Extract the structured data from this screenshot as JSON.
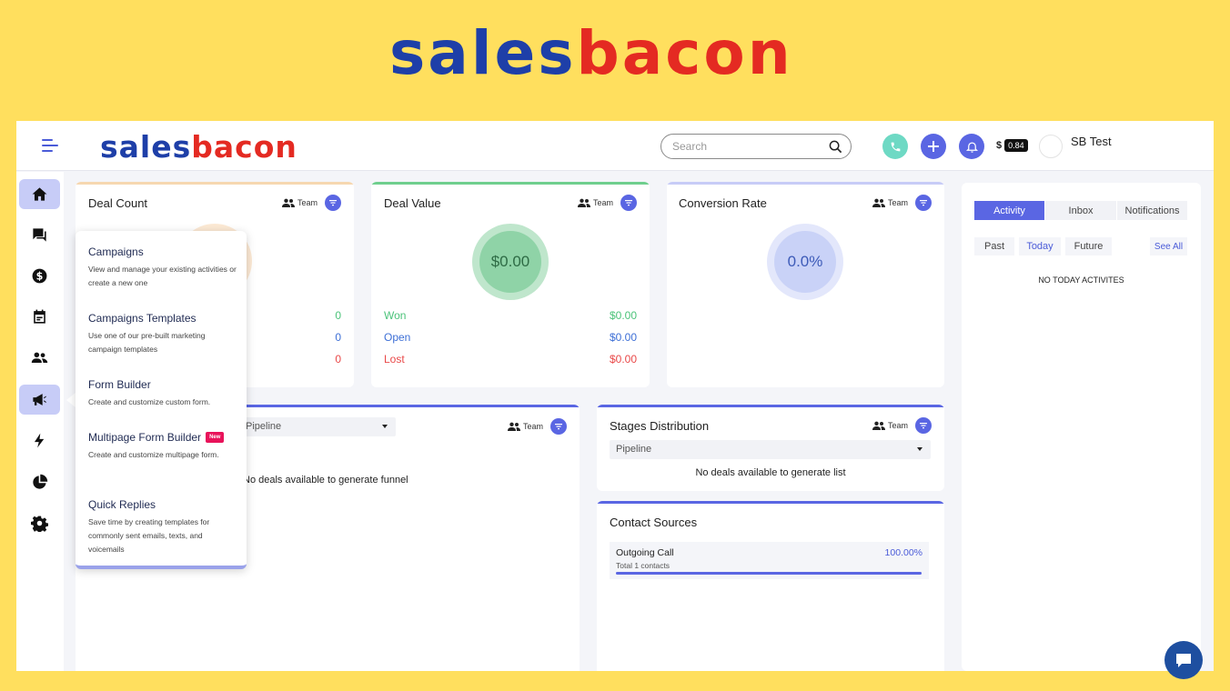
{
  "brand": {
    "part1": "sales",
    "part2": "bacon",
    "blue": "#1E3FA8",
    "red": "#E42A22"
  },
  "header": {
    "search_placeholder": "Search",
    "balance_symbol": "$",
    "balance_value": "0.84",
    "user_name": "SB Test"
  },
  "sidebar": {
    "items": [
      "home-icon",
      "chat-icon",
      "dollar-icon",
      "calendar-icon",
      "contacts-icon",
      "megaphone-icon",
      "bolt-icon",
      "pie-chart-icon",
      "gear-icon"
    ],
    "active": [
      "home-icon",
      "megaphone-icon"
    ]
  },
  "deal_count": {
    "title": "Deal Count",
    "team": "Team",
    "rows": [
      "0",
      "0",
      "0"
    ]
  },
  "deal_value": {
    "title": "Deal Value",
    "team": "Team",
    "total": "$0.00",
    "rows": [
      {
        "label": "Won",
        "value": "$0.00",
        "color": "#4CC37A"
      },
      {
        "label": "Open",
        "value": "$0.00",
        "color": "#3D6FD6"
      },
      {
        "label": "Lost",
        "value": "$0.00",
        "color": "#E94848"
      }
    ]
  },
  "conversion_rate": {
    "title": "Conversion Rate",
    "team": "Team",
    "value": "0.0%"
  },
  "funnel": {
    "select": "Pipeline",
    "team": "Team",
    "empty": "No deals available to generate funnel"
  },
  "stages": {
    "title": "Stages Distribution",
    "team": "Team",
    "select": "Pipeline",
    "empty": "No deals available to generate list"
  },
  "contact_sources": {
    "title": "Contact Sources",
    "items": [
      {
        "name": "Outgoing Call",
        "sub": "Total 1 contacts",
        "percent": "100.00%",
        "fraction": 1.0
      }
    ]
  },
  "activity_panel": {
    "tabs": [
      "Activity",
      "Inbox",
      "Notifications"
    ],
    "time_tabs": [
      "Past",
      "Today",
      "Future"
    ],
    "see_all": "See All",
    "empty": "NO TODAY ACTIVITES"
  },
  "menu": {
    "items": [
      {
        "title": "Campaigns",
        "desc": "View and manage your existing activities or create a new one"
      },
      {
        "title": "Campaigns Templates",
        "desc": "Use one of our pre-built marketing campaign templates"
      },
      {
        "title": "Form Builder",
        "desc": "Create and customize custom form."
      },
      {
        "title": "Multipage Form Builder",
        "badge": "New",
        "desc": "Create and customize multipage form."
      },
      {
        "title": "Quick Replies",
        "desc": "Save time by creating templates for commonly sent emails, texts, and voicemails"
      }
    ]
  }
}
